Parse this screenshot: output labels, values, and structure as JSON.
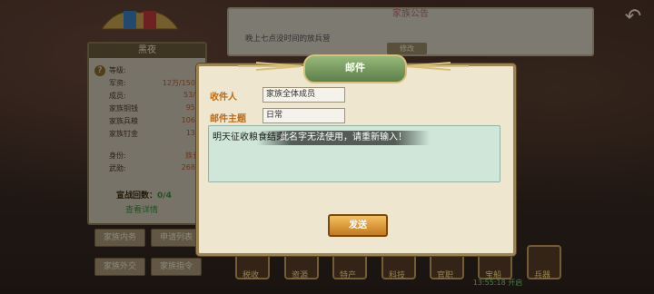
{
  "family_notice": {
    "title": "家族公告",
    "text": "晚上七点没时间的放兵营",
    "edit_label": "修改"
  },
  "family_panel": {
    "name": "黑夜",
    "stats": [
      {
        "label": "等级:",
        "value": ""
      },
      {
        "label": "军资:",
        "value": "12万/1500"
      },
      {
        "label": "成员:",
        "value": "53/5"
      },
      {
        "label": "家族铜钱",
        "value": "957"
      },
      {
        "label": "家族兵粮",
        "value": "1065"
      },
      {
        "label": "家族钉金",
        "value": "137"
      },
      {
        "label": "身份:",
        "value": "族长"
      },
      {
        "label": "武勋:",
        "value": "2680"
      }
    ],
    "battle_label": "宣战回数：",
    "battle_value": "0/4",
    "detail_link": "查看详情",
    "buttons": [
      "家族内务",
      "申请列表",
      "家族外交",
      "家族指令"
    ]
  },
  "bottom_icons": [
    {
      "label": "税收"
    },
    {
      "label": "资源"
    },
    {
      "label": "特产"
    },
    {
      "label": "科技"
    },
    {
      "label": "官职"
    },
    {
      "label": "宝船"
    },
    {
      "label": "兵器"
    }
  ],
  "bottom_timer": "13:55:18 开启",
  "mail": {
    "title": "邮件",
    "recipient_label": "收件人",
    "recipient_value": "家族全体成员",
    "subject_label": "邮件主题",
    "subject_value": "日常",
    "body": "明天征收粮食结束",
    "send_label": "发送"
  },
  "toast": "此名字无法使用，请重新输入！",
  "colors": {
    "accent_orange": "#c06a14",
    "dialog_bg": "#eee6cf",
    "title_green": "#5c7f4a",
    "button_gold": "#f4c060"
  }
}
